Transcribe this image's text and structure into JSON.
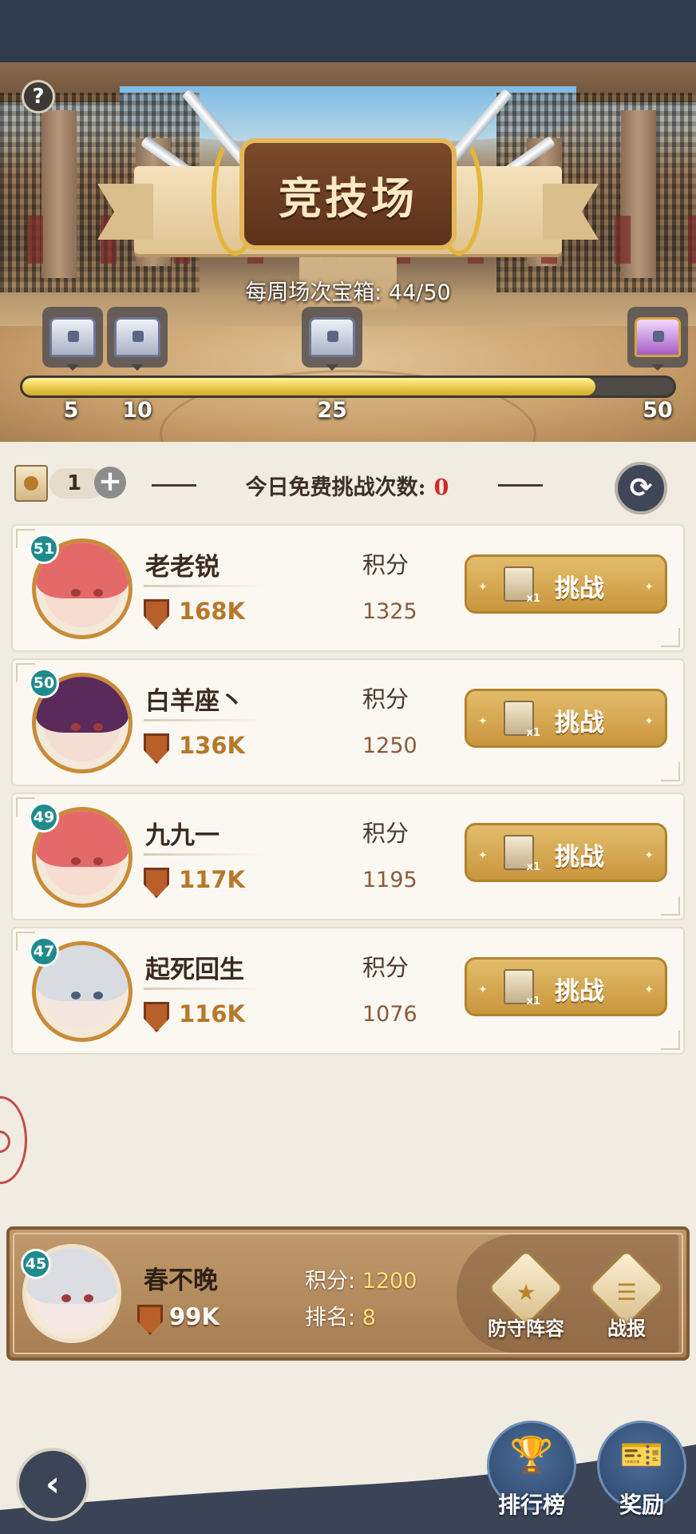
{
  "banner": {
    "title": "竞技场",
    "weekly_label": "每周场次宝箱: 44/50",
    "progress": 0.88,
    "milestones": [
      "5",
      "10",
      "25",
      "50"
    ]
  },
  "challenge": {
    "ticket_count": "1",
    "free_label": "今日免费挑战次数:",
    "free_count": "0"
  },
  "opponents": [
    {
      "level": "51",
      "name": "老老锐",
      "power": "168K",
      "score_label": "积分",
      "score": "1325",
      "button": "挑战"
    },
    {
      "level": "50",
      "name": "白羊座丶",
      "power": "136K",
      "score_label": "积分",
      "score": "1250",
      "button": "挑战"
    },
    {
      "level": "49",
      "name": "九九一",
      "power": "117K",
      "score_label": "积分",
      "score": "1195",
      "button": "挑战"
    },
    {
      "level": "47",
      "name": "起死回生",
      "power": "116K",
      "score_label": "积分",
      "score": "1076",
      "button": "挑战"
    }
  ],
  "player": {
    "level": "45",
    "name": "春不晚",
    "power": "99K",
    "score_label": "积分:",
    "score": "1200",
    "rank_label": "排名:",
    "rank": "8",
    "defense_label": "防守阵容",
    "report_label": "战报"
  },
  "nav": {
    "ranking_label": "排行榜",
    "reward_label": "奖励"
  },
  "colors": {
    "level_badge": "#1f8b8c",
    "free_count": "#d12a2a",
    "button_gold": "#d4a44c"
  }
}
